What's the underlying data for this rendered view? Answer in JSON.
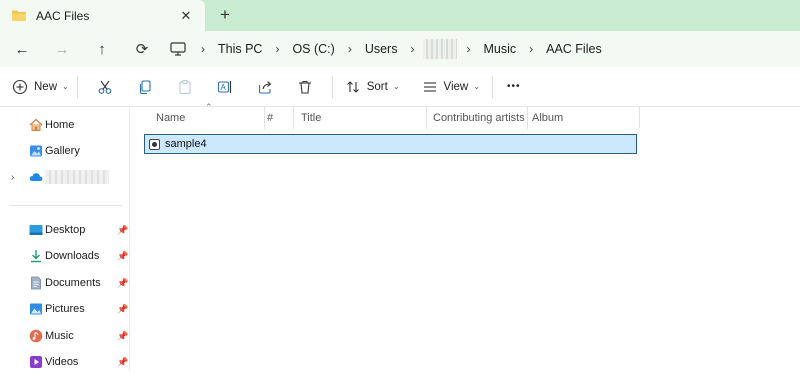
{
  "tab": {
    "title": "AAC Files",
    "close_icon": "close-icon",
    "new_tab": "+"
  },
  "nav": {
    "back": "←",
    "forward": "→",
    "up": "↑",
    "refresh": "⟳"
  },
  "breadcrumb": [
    "This PC",
    "OS (C:)",
    "Users",
    "Music",
    "AAC Files"
  ],
  "toolbar": {
    "new_label": "New",
    "sort_label": "Sort",
    "view_label": "View",
    "more_label": "•••"
  },
  "sidebar": {
    "top": [
      {
        "label": "Home"
      },
      {
        "label": "Gallery"
      }
    ],
    "pinned": [
      {
        "label": "Desktop"
      },
      {
        "label": "Downloads"
      },
      {
        "label": "Documents"
      },
      {
        "label": "Pictures"
      },
      {
        "label": "Music"
      },
      {
        "label": "Videos"
      }
    ]
  },
  "columns": {
    "name": "Name",
    "number": "#",
    "title": "Title",
    "artists": "Contributing artists",
    "album": "Album"
  },
  "files": [
    {
      "name": "sample4"
    }
  ],
  "colors": {
    "tabbar": "#c9ebd0",
    "addrbar": "#f3faf4",
    "selection": "#cce8ff",
    "selection_border": "#2b5c7a",
    "folder": "#f4c44f"
  }
}
